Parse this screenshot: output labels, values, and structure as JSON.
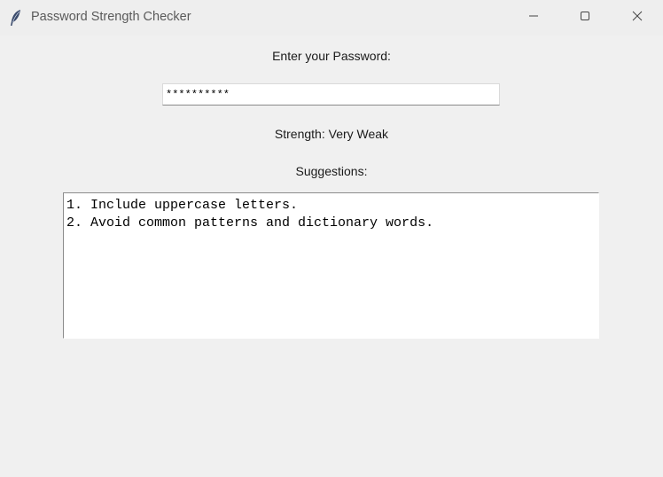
{
  "window": {
    "title": "Password Strength Checker",
    "app_icon": "feather-icon",
    "controls": {
      "minimize_icon": "minimize-icon",
      "maximize_icon": "maximize-icon",
      "close_icon": "close-icon"
    }
  },
  "form": {
    "prompt_label": "Enter your Password:",
    "password_value": "**********",
    "strength_label": "Strength: Very Weak",
    "suggestions_label": "Suggestions:",
    "suggestions": [
      "1. Include uppercase letters.",
      "2. Avoid common patterns and dictionary words."
    ]
  },
  "colors": {
    "background": "#f0f0f0",
    "titlebar": "#eeeeee",
    "field_background": "#ffffff"
  }
}
